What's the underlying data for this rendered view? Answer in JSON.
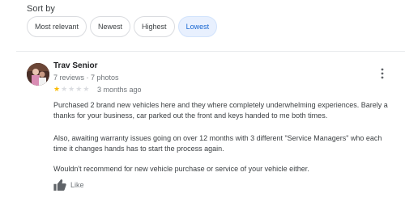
{
  "sort": {
    "label": "Sort by",
    "options": [
      {
        "label": "Most relevant"
      },
      {
        "label": "Newest"
      },
      {
        "label": "Highest"
      },
      {
        "label": "Lowest"
      }
    ],
    "selected": "Lowest"
  },
  "review": {
    "author": "Trav Senior",
    "author_meta": "7 reviews · 7 photos",
    "rating": 1,
    "rating_max": 5,
    "date": "3 months ago",
    "paragraphs": [
      [
        "Purchased 2 brand new vehicles here and they where completely underwhelming experiences. Barely a",
        "thanks for your business, car parked out the front and keys handed to me both times."
      ],
      [
        "Also, awaiting warranty issues going on over 12 months with 3 different \"Service Managers\" who each",
        "time it changes hands has to start the process again."
      ],
      [
        "Wouldn't recommend for new vehicle purchase or service of your vehicle either."
      ]
    ],
    "like_label": "Like",
    "icons": {
      "more": "more-vert-icon",
      "like": "thumb-up-icon",
      "star": "star-icon"
    },
    "colors": {
      "star_filled": "#fbbc04",
      "star_empty": "#dadce0",
      "chip_active_bg": "#e8f0fe",
      "chip_active_text": "#1967d2"
    }
  }
}
